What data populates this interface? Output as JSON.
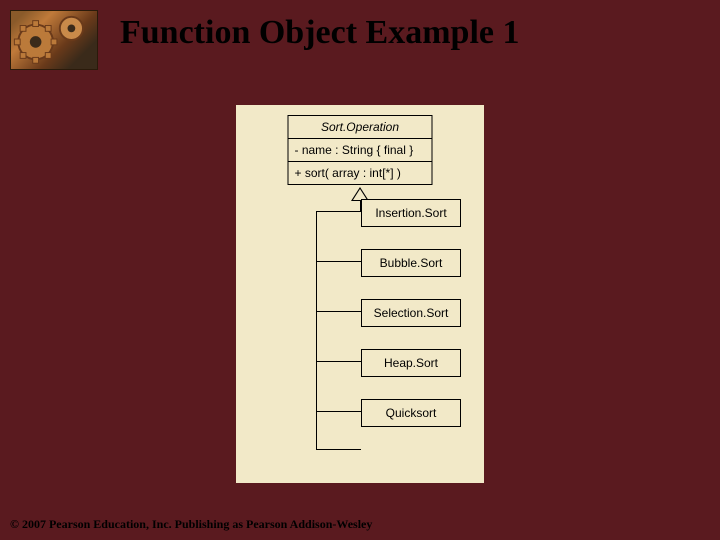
{
  "title": "Function Object Example 1",
  "copyright": "© 2007 Pearson Education, Inc. Publishing as Pearson Addison-Wesley",
  "uml": {
    "classname": "Sort.Operation",
    "attributes": "- name : String { final }",
    "operations": "+ sort( array : int[*] )",
    "subclasses": {
      "0": "Insertion.Sort",
      "1": "Bubble.Sort",
      "2": "Selection.Sort",
      "3": "Heap.Sort",
      "4": "Quicksort"
    }
  }
}
